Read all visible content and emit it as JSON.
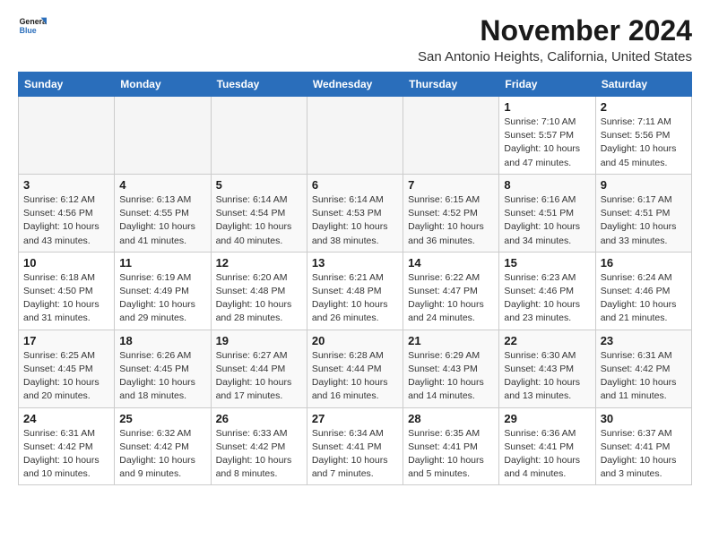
{
  "logo": {
    "line1": "General",
    "line2": "Blue"
  },
  "title": "November 2024",
  "location": "San Antonio Heights, California, United States",
  "weekdays": [
    "Sunday",
    "Monday",
    "Tuesday",
    "Wednesday",
    "Thursday",
    "Friday",
    "Saturday"
  ],
  "weeks": [
    [
      {
        "day": "",
        "info": ""
      },
      {
        "day": "",
        "info": ""
      },
      {
        "day": "",
        "info": ""
      },
      {
        "day": "",
        "info": ""
      },
      {
        "day": "",
        "info": ""
      },
      {
        "day": "1",
        "info": "Sunrise: 7:10 AM\nSunset: 5:57 PM\nDaylight: 10 hours and 47 minutes."
      },
      {
        "day": "2",
        "info": "Sunrise: 7:11 AM\nSunset: 5:56 PM\nDaylight: 10 hours and 45 minutes."
      }
    ],
    [
      {
        "day": "3",
        "info": "Sunrise: 6:12 AM\nSunset: 4:56 PM\nDaylight: 10 hours and 43 minutes."
      },
      {
        "day": "4",
        "info": "Sunrise: 6:13 AM\nSunset: 4:55 PM\nDaylight: 10 hours and 41 minutes."
      },
      {
        "day": "5",
        "info": "Sunrise: 6:14 AM\nSunset: 4:54 PM\nDaylight: 10 hours and 40 minutes."
      },
      {
        "day": "6",
        "info": "Sunrise: 6:14 AM\nSunset: 4:53 PM\nDaylight: 10 hours and 38 minutes."
      },
      {
        "day": "7",
        "info": "Sunrise: 6:15 AM\nSunset: 4:52 PM\nDaylight: 10 hours and 36 minutes."
      },
      {
        "day": "8",
        "info": "Sunrise: 6:16 AM\nSunset: 4:51 PM\nDaylight: 10 hours and 34 minutes."
      },
      {
        "day": "9",
        "info": "Sunrise: 6:17 AM\nSunset: 4:51 PM\nDaylight: 10 hours and 33 minutes."
      }
    ],
    [
      {
        "day": "10",
        "info": "Sunrise: 6:18 AM\nSunset: 4:50 PM\nDaylight: 10 hours and 31 minutes."
      },
      {
        "day": "11",
        "info": "Sunrise: 6:19 AM\nSunset: 4:49 PM\nDaylight: 10 hours and 29 minutes."
      },
      {
        "day": "12",
        "info": "Sunrise: 6:20 AM\nSunset: 4:48 PM\nDaylight: 10 hours and 28 minutes."
      },
      {
        "day": "13",
        "info": "Sunrise: 6:21 AM\nSunset: 4:48 PM\nDaylight: 10 hours and 26 minutes."
      },
      {
        "day": "14",
        "info": "Sunrise: 6:22 AM\nSunset: 4:47 PM\nDaylight: 10 hours and 24 minutes."
      },
      {
        "day": "15",
        "info": "Sunrise: 6:23 AM\nSunset: 4:46 PM\nDaylight: 10 hours and 23 minutes."
      },
      {
        "day": "16",
        "info": "Sunrise: 6:24 AM\nSunset: 4:46 PM\nDaylight: 10 hours and 21 minutes."
      }
    ],
    [
      {
        "day": "17",
        "info": "Sunrise: 6:25 AM\nSunset: 4:45 PM\nDaylight: 10 hours and 20 minutes."
      },
      {
        "day": "18",
        "info": "Sunrise: 6:26 AM\nSunset: 4:45 PM\nDaylight: 10 hours and 18 minutes."
      },
      {
        "day": "19",
        "info": "Sunrise: 6:27 AM\nSunset: 4:44 PM\nDaylight: 10 hours and 17 minutes."
      },
      {
        "day": "20",
        "info": "Sunrise: 6:28 AM\nSunset: 4:44 PM\nDaylight: 10 hours and 16 minutes."
      },
      {
        "day": "21",
        "info": "Sunrise: 6:29 AM\nSunset: 4:43 PM\nDaylight: 10 hours and 14 minutes."
      },
      {
        "day": "22",
        "info": "Sunrise: 6:30 AM\nSunset: 4:43 PM\nDaylight: 10 hours and 13 minutes."
      },
      {
        "day": "23",
        "info": "Sunrise: 6:31 AM\nSunset: 4:42 PM\nDaylight: 10 hours and 11 minutes."
      }
    ],
    [
      {
        "day": "24",
        "info": "Sunrise: 6:31 AM\nSunset: 4:42 PM\nDaylight: 10 hours and 10 minutes."
      },
      {
        "day": "25",
        "info": "Sunrise: 6:32 AM\nSunset: 4:42 PM\nDaylight: 10 hours and 9 minutes."
      },
      {
        "day": "26",
        "info": "Sunrise: 6:33 AM\nSunset: 4:42 PM\nDaylight: 10 hours and 8 minutes."
      },
      {
        "day": "27",
        "info": "Sunrise: 6:34 AM\nSunset: 4:41 PM\nDaylight: 10 hours and 7 minutes."
      },
      {
        "day": "28",
        "info": "Sunrise: 6:35 AM\nSunset: 4:41 PM\nDaylight: 10 hours and 5 minutes."
      },
      {
        "day": "29",
        "info": "Sunrise: 6:36 AM\nSunset: 4:41 PM\nDaylight: 10 hours and 4 minutes."
      },
      {
        "day": "30",
        "info": "Sunrise: 6:37 AM\nSunset: 4:41 PM\nDaylight: 10 hours and 3 minutes."
      }
    ]
  ]
}
